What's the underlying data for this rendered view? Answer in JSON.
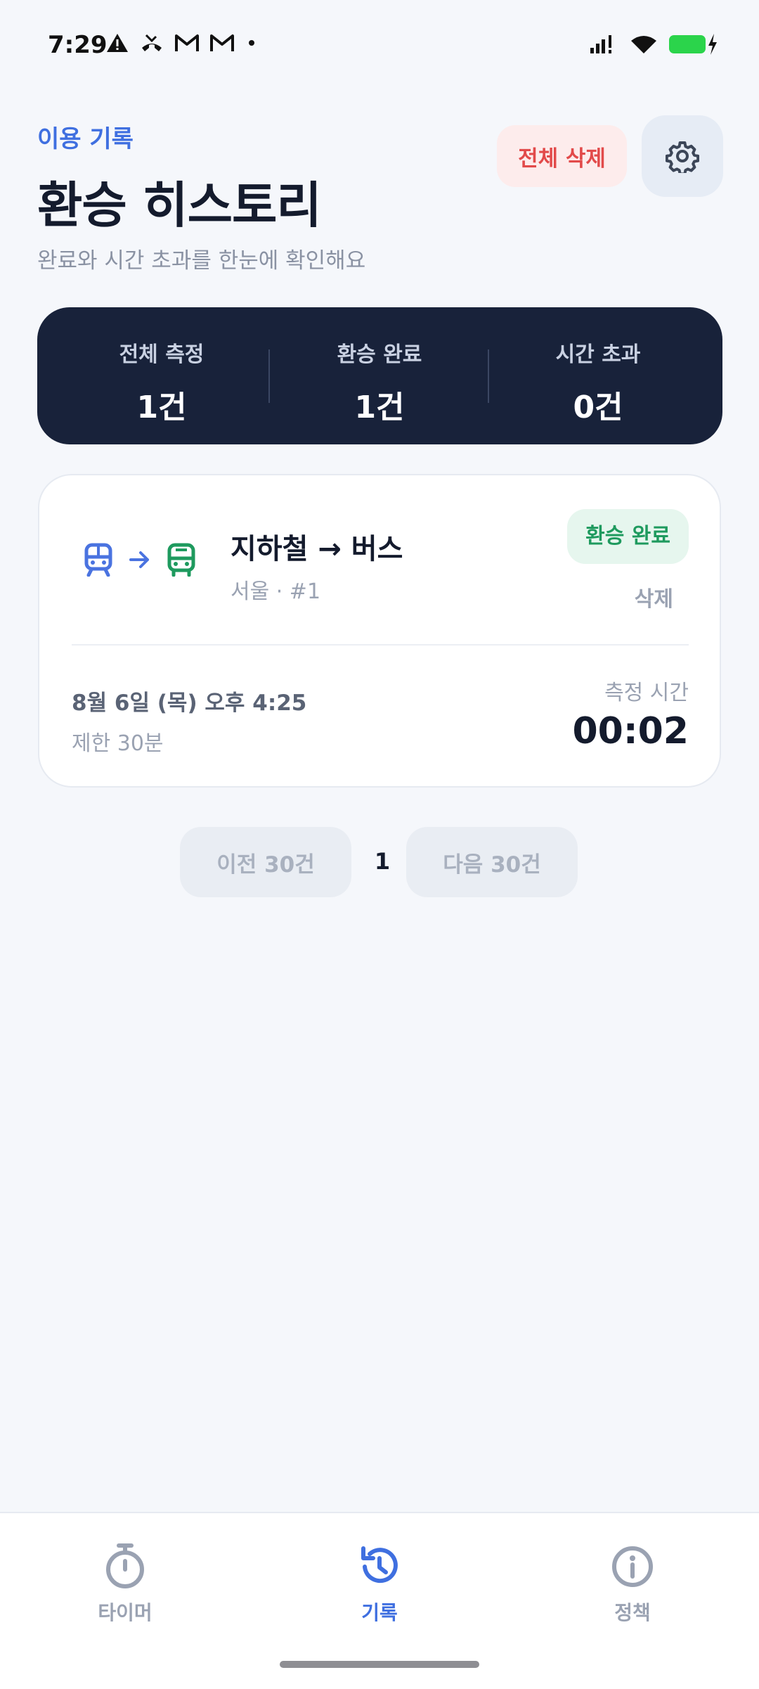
{
  "status_bar": {
    "time": "7:29"
  },
  "header": {
    "eyebrow": "이용 기록",
    "title": "환승 히스토리",
    "subtitle": "완료와 시간 초과를 한눈에 확인해요",
    "delete_all_label": "전체 삭제"
  },
  "summary": {
    "items": [
      {
        "label": "전체 측정",
        "value": "1건"
      },
      {
        "label": "환승 완료",
        "value": "1건"
      },
      {
        "label": "시간 초과",
        "value": "0건"
      }
    ]
  },
  "records": [
    {
      "route": "지하철 → 버스",
      "sub": "서울 · #1",
      "status": "환승 완료",
      "delete_label": "삭제",
      "date": "8월 6일 (목) 오후 4:25",
      "limit": "제한 30분",
      "measure_label": "측정 시간",
      "measure_value": "00:02"
    }
  ],
  "pager": {
    "prev_label": "이전 30건",
    "page": "1",
    "next_label": "다음 30건"
  },
  "bottom_nav": {
    "items": [
      {
        "label": "타이머",
        "icon": "stopwatch-icon"
      },
      {
        "label": "기록",
        "icon": "history-icon",
        "active": true
      },
      {
        "label": "정책",
        "icon": "info-icon"
      }
    ]
  },
  "colors": {
    "accent": "#3F6FE0",
    "danger": "#E24A4A",
    "success": "#1E9A5E",
    "summary_bg": "#18223A",
    "subway_icon": "#4A73E0",
    "bus_icon": "#1E9A5E"
  }
}
